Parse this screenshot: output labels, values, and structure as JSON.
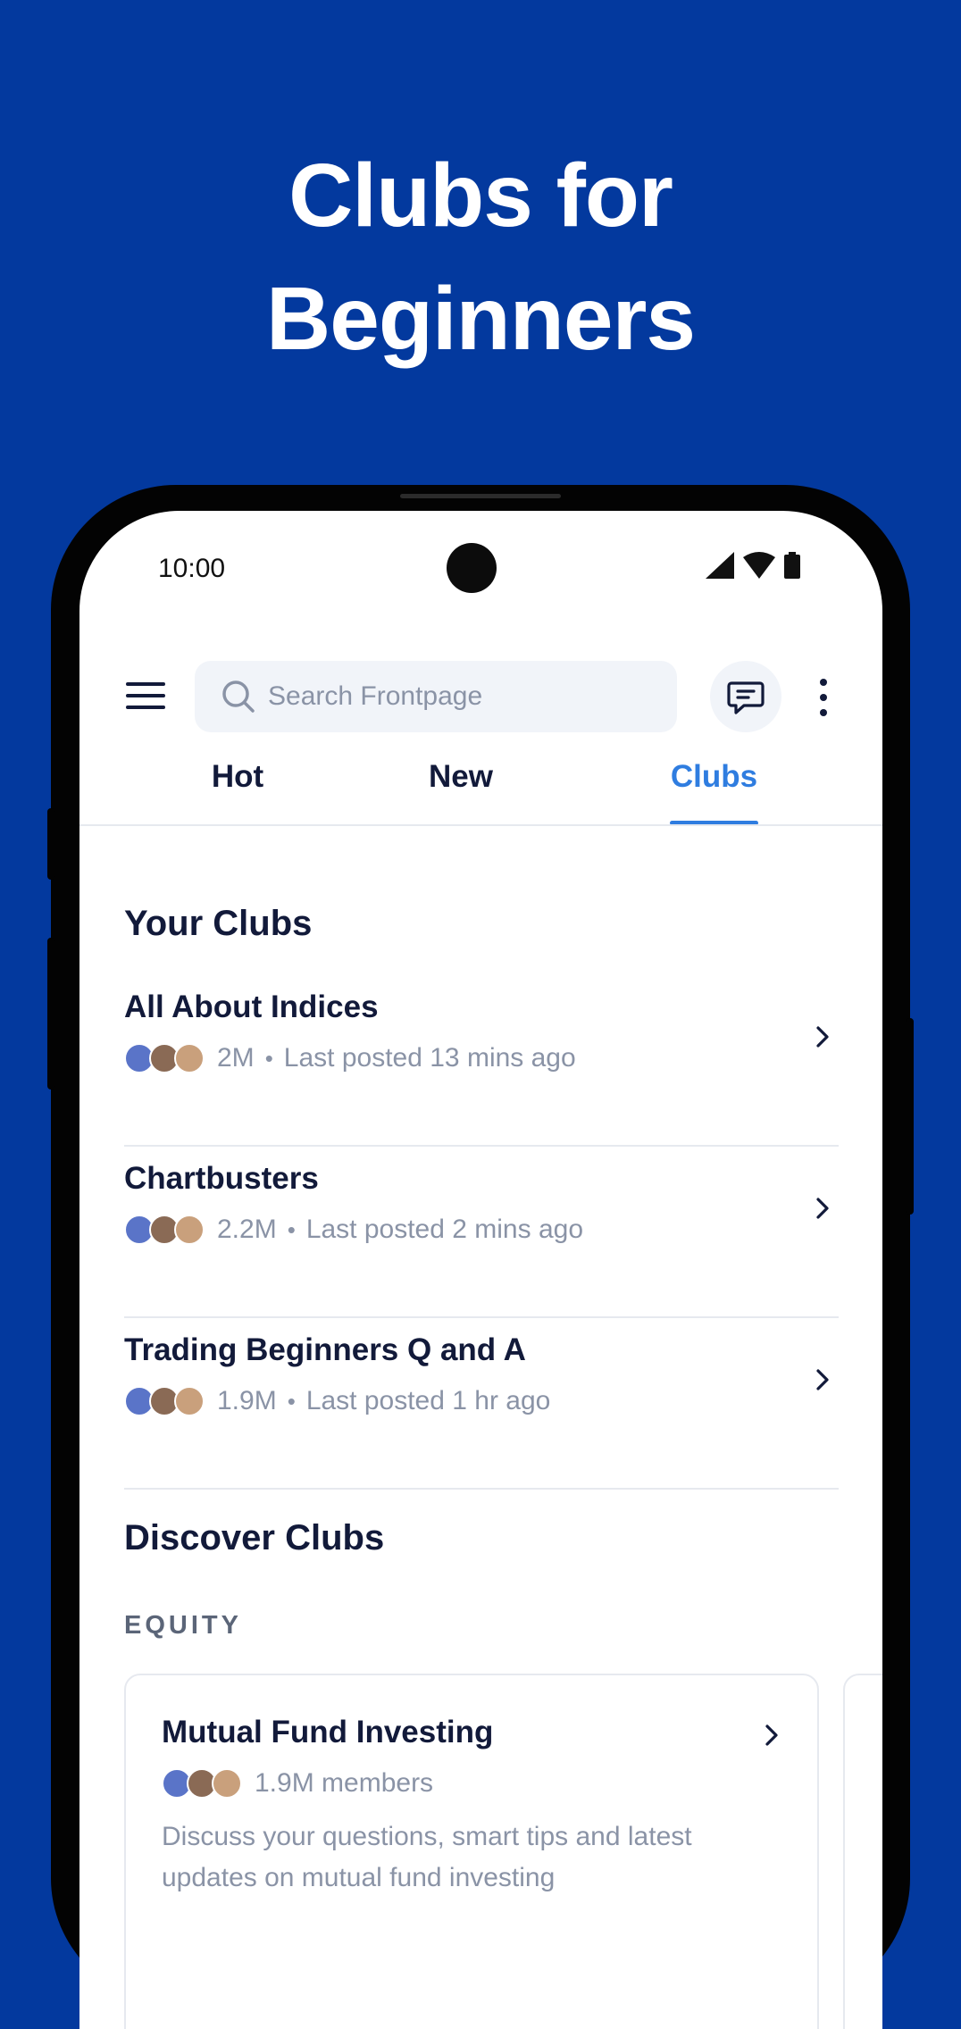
{
  "promo": {
    "title_line1": "Clubs for",
    "title_line2": "Beginners"
  },
  "status_bar": {
    "time": "10:00",
    "icons": [
      "signal-icon",
      "wifi-icon",
      "battery-icon"
    ]
  },
  "header": {
    "menu_icon": "hamburger-menu-icon",
    "search_placeholder": "Search Frontpage",
    "search_icon": "search-icon",
    "chat_icon": "chat-icon",
    "more_icon": "more-vertical-icon"
  },
  "tabs": [
    {
      "label": "Hot",
      "active": false
    },
    {
      "label": "New",
      "active": false
    },
    {
      "label": "Clubs",
      "active": true
    }
  ],
  "your_clubs": {
    "title": "Your Clubs",
    "items": [
      {
        "name": "All About Indices",
        "members": "2M",
        "last_posted": "Last posted 13 mins ago"
      },
      {
        "name": "Chartbusters",
        "members": "2.2M",
        "last_posted": "Last posted 2 mins ago"
      },
      {
        "name": "Trading Beginners Q and A",
        "members": "1.9M",
        "last_posted": "Last posted 1 hr ago"
      }
    ]
  },
  "discover": {
    "title": "Discover Clubs",
    "category": "EQUITY",
    "cards": [
      {
        "name": "Mutual Fund Investing",
        "members": "1.9M members",
        "description": "Discuss your questions, smart tips and latest updates on mutual fund investing"
      }
    ]
  },
  "colors": {
    "background": "#03399e",
    "accent": "#2f7de0",
    "text_dark": "#121a3a",
    "text_muted": "#8a93a6"
  },
  "separator": "•"
}
